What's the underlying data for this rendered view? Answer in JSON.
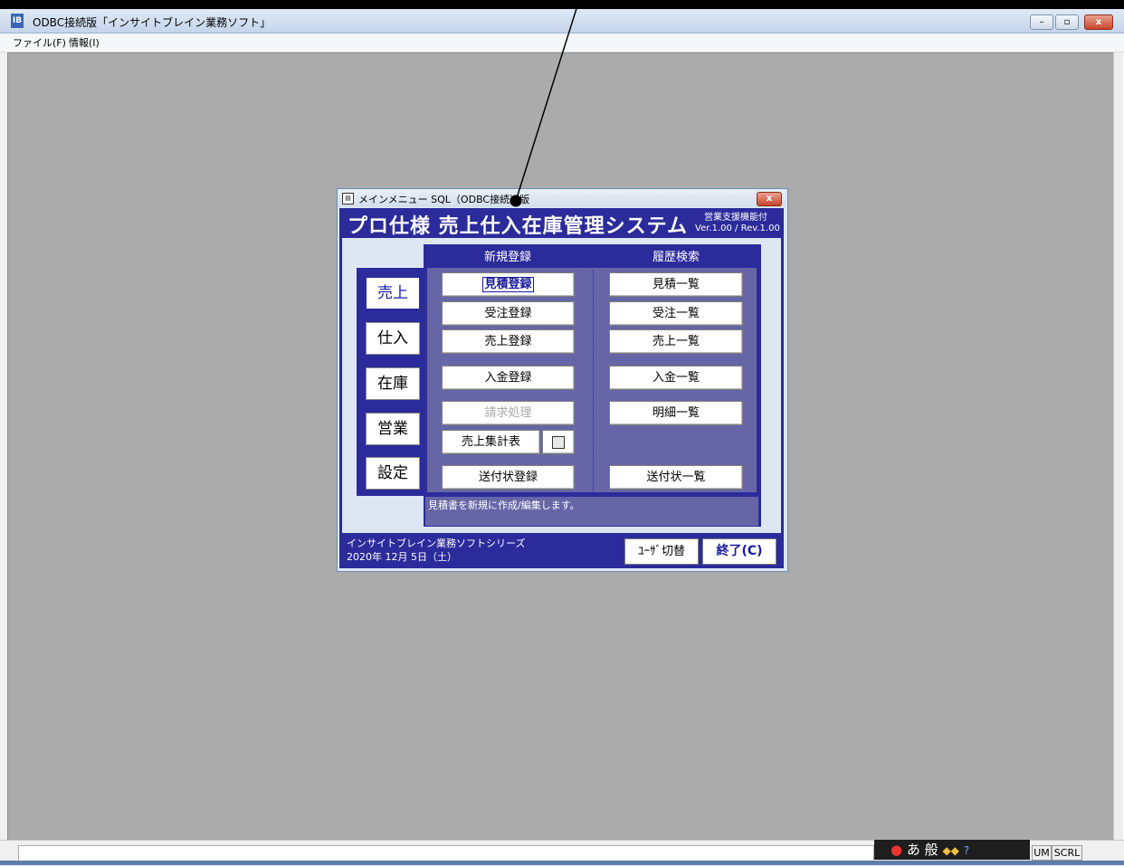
{
  "app": {
    "title": "ODBC接続版「インサイトブレイン業務ソフト」",
    "icon_label": "IB",
    "menu": [
      "ファイル(F)",
      "情報(I)"
    ],
    "window_controls": {
      "minimize": "–",
      "maximize": "▫",
      "close": "x"
    }
  },
  "dialog": {
    "title": "メインメニュー SQL（ODBC接続）版",
    "close_label": "x",
    "header": {
      "title": "プロ仕様 売上仕入在庫管理システム",
      "subtitle": "営業支援機能付",
      "version": "Ver.1.00 / Rev.1.00"
    },
    "tabs": [
      {
        "label": "売上",
        "active": true
      },
      {
        "label": "仕入",
        "active": false
      },
      {
        "label": "在庫",
        "active": false
      },
      {
        "label": "営業",
        "active": false
      },
      {
        "label": "設定",
        "active": false
      }
    ],
    "columns": {
      "new": "新規登録",
      "history": "履歴検索"
    },
    "new_buttons": [
      {
        "label": "見積登録",
        "focused": true
      },
      {
        "label": "受注登録"
      },
      {
        "label": "売上登録"
      },
      {
        "label": "入金登録"
      },
      {
        "label": "請求処理",
        "disabled": true
      },
      {
        "label": "売上集計表"
      },
      {
        "label": "送付状登録"
      }
    ],
    "history_buttons": [
      {
        "label": "見積一覧"
      },
      {
        "label": "受注一覧"
      },
      {
        "label": "売上一覧"
      },
      {
        "label": "入金一覧"
      },
      {
        "label": "明細一覧"
      },
      {
        "label": "送付状一覧"
      }
    ],
    "status_message": "見積書を新規に作成/編集します。",
    "footer": {
      "series": "インサイトブレイン業務ソフトシリーズ",
      "date": "2020年 12月 5日（土）",
      "switch_user_label": "ﾕｰｻﾞ切替",
      "exit_label": "終了(C)"
    }
  },
  "statusbar": {
    "ime": "あ 般",
    "indicators": [
      "UM",
      "SCRL"
    ]
  },
  "colors": {
    "dialog_navy": "#2b2b9b",
    "panel_slate": "#6666a6",
    "mdi_background": "#ababab"
  }
}
